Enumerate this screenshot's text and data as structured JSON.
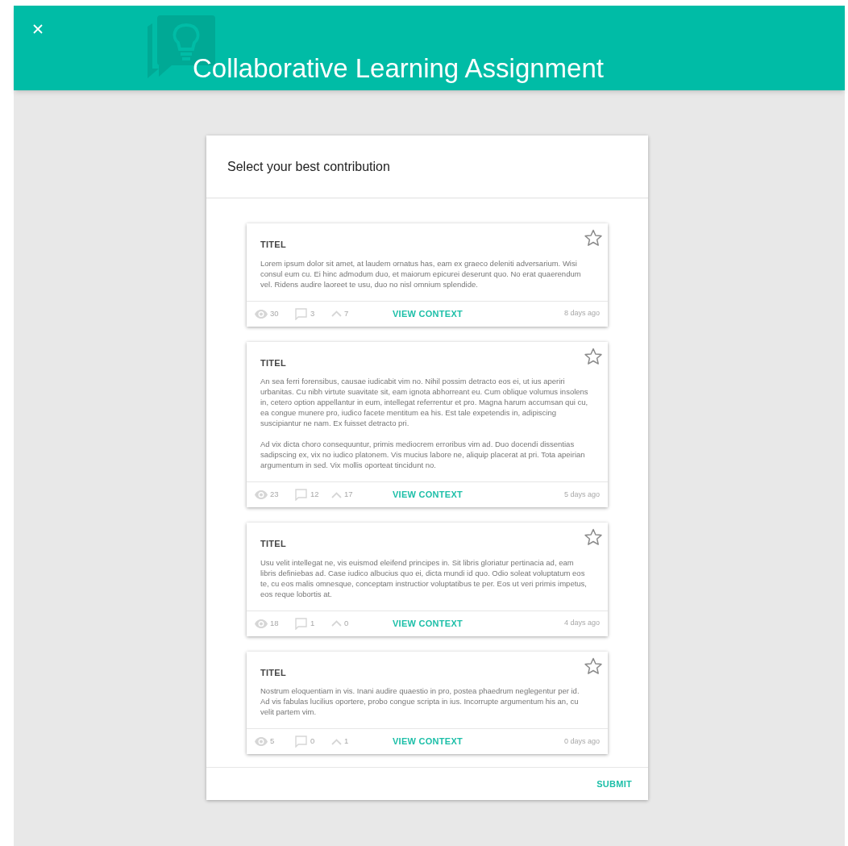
{
  "header": {
    "title": "Collaborative Learning Assignment"
  },
  "dialog": {
    "title": "Select your best contribution",
    "submit": "SUBMIT",
    "contributions": [
      {
        "title": "TITEL",
        "starred": false,
        "paragraphs": [
          "Lorem ipsum dolor sit amet, at laudem ornatus has, eam ex graeco deleniti adversarium. Wisi consul eum cu. Ei hinc admodum duo, et maiorum epicurei deserunt quo. No erat quaerendum vel. Ridens audire laoreet te usu, duo no nisl omnium splendide."
        ],
        "views": "30",
        "comments": "3",
        "upvotes": "7",
        "action": "VIEW CONTEXT",
        "age": "8 days ago"
      },
      {
        "title": "TITEL",
        "starred": false,
        "paragraphs": [
          "An sea ferri forensibus, causae iudicabit vim no. Nihil possim detracto eos ei, ut ius aperiri urbanitas. Cu nibh virtute suavitate sit, eam ignota abhorreant eu. Cum oblique volumus insolens in, cetero option appellantur in eum, intellegat referrentur et pro. Magna harum accumsan qui cu, ea congue munere pro, iudico facete mentitum ea his. Est tale expetendis in, adipiscing suscipiantur ne nam. Ex fuisset detracto pri.",
          "Ad vix dicta choro consequuntur, primis mediocrem erroribus vim ad. Duo docendi dissentias sadipscing ex, vix no iudico platonem. Vis mucius labore ne, aliquip placerat at pri. Tota apeirian argumentum in sed. Vix mollis oporteat tincidunt no."
        ],
        "views": "23",
        "comments": "12",
        "upvotes": "17",
        "action": "VIEW CONTEXT",
        "age": "5 days ago"
      },
      {
        "title": "TITEL",
        "starred": false,
        "paragraphs": [
          "Usu velit intellegat ne, vis euismod eleifend principes in. Sit libris gloriatur pertinacia ad, eam libris definiebas ad. Case iudico albucius quo ei, dicta mundi id quo. Odio soleat voluptatum eos te, cu eos malis omnesque, conceptam instructior voluptatibus te per. Eos ut veri primis impetus, eos reque lobortis at."
        ],
        "views": "18",
        "comments": "1",
        "upvotes": "0",
        "action": "VIEW CONTEXT",
        "age": "4 days ago"
      },
      {
        "title": "TITEL",
        "starred": false,
        "paragraphs": [
          "Nostrum eloquentiam in vis. Inani audire quaestio in pro, postea phaedrum neglegentur per id. Ad vis fabulas lucilius oportere, probo congue scripta in ius. Incorrupte argumentum his an, cu velit partem vim."
        ],
        "views": "5",
        "comments": "0",
        "upvotes": "1",
        "action": "VIEW CONTEXT",
        "age": "0 days ago"
      }
    ]
  }
}
